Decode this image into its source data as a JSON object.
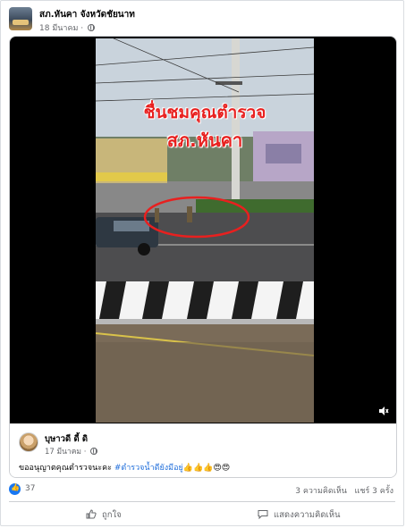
{
  "post": {
    "page_name": "สภ.หันคา จังหวัดชัยนาท",
    "date": "18 มีนาคม",
    "separator": " · "
  },
  "video": {
    "overlay_line1": "ชื่นชมคุณตำรวจ",
    "overlay_line2": "สภ.หันคา",
    "volume_icon": "volume-icon"
  },
  "shared": {
    "sharer_name": "บุษาวดี ดี้ ดิ",
    "date": "17 มีนาคม",
    "text_before": "ขออนุญาตคุณตำรวจนะคะ ",
    "hashtag": "#ตำรวจน้ำดียังมีอยู่",
    "emojis": "👍👍👍😍😍"
  },
  "stats": {
    "like_count": "37",
    "comments": "3 ความคิดเห็น",
    "shares": "แชร์ 3 ครั้ง"
  },
  "actions": {
    "like_label": "ถูกใจ",
    "comment_label": "แสดงความคิดเห็น"
  },
  "colors": {
    "facebook_blue": "#1877f2",
    "hashtag": "#216fdb",
    "overlay_red": "#e8201f"
  }
}
